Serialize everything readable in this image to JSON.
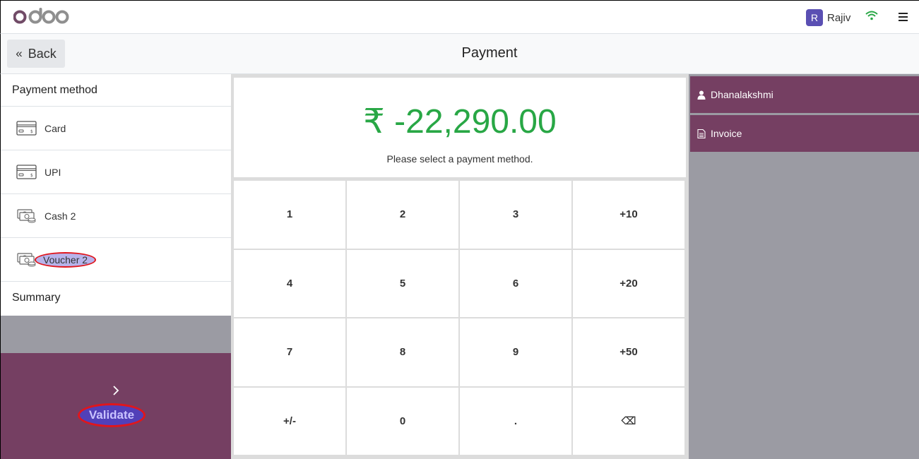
{
  "header": {
    "logo_text": "odoo",
    "user_initial": "R",
    "user_name": "Rajiv",
    "wifi_color": "#28a745"
  },
  "subheader": {
    "back_label": "Back",
    "title": "Payment"
  },
  "payment_methods": {
    "title": "Payment method",
    "items": [
      {
        "label": "Card",
        "icon": "card-icon"
      },
      {
        "label": "UPI",
        "icon": "card-icon"
      },
      {
        "label": "Cash 2",
        "icon": "cash-icon"
      },
      {
        "label": "Voucher 2",
        "icon": "cash-icon"
      }
    ]
  },
  "summary": {
    "title": "Summary"
  },
  "validate": {
    "label": "Validate"
  },
  "amount": {
    "value": "₹ -22,290.00",
    "hint": "Please select a payment method."
  },
  "keypad": [
    "1",
    "2",
    "3",
    "+10",
    "4",
    "5",
    "6",
    "+20",
    "7",
    "8",
    "9",
    "+50",
    "+/-",
    "0",
    ".",
    "⌫"
  ],
  "right_panel": {
    "customer_label": "Dhanalakshmi",
    "invoice_label": "Invoice"
  },
  "colors": {
    "brand": "#753f62",
    "amount": "#28a745",
    "gray_panel": "#9b9ba3"
  }
}
